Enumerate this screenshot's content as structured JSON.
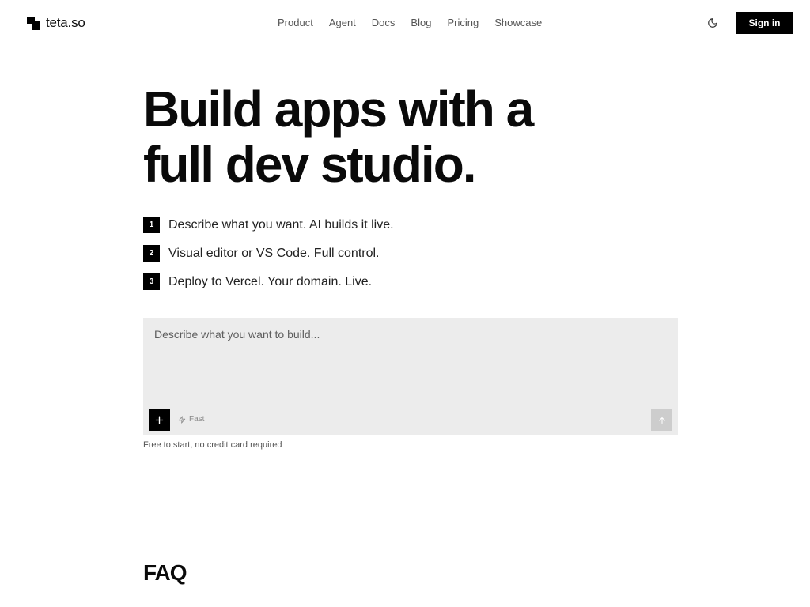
{
  "header": {
    "logo_text": "teta.so",
    "logo_icon": "teta-logo-icon",
    "nav": [
      {
        "label": "Product"
      },
      {
        "label": "Agent"
      },
      {
        "label": "Docs"
      },
      {
        "label": "Blog"
      },
      {
        "label": "Pricing"
      },
      {
        "label": "Showcase"
      }
    ],
    "theme_toggle_icon": "moon-icon",
    "sign_in_label": "Sign in"
  },
  "hero": {
    "title_lines": [
      "Build apps with a",
      "full dev studio."
    ],
    "steps": [
      {
        "number": "1",
        "text": "Describe what you want. AI builds it live."
      },
      {
        "number": "2",
        "text": "Visual editor or VS Code. Full control."
      },
      {
        "number": "3",
        "text": "Deploy to Vercel. Your domain. Live."
      }
    ]
  },
  "prompt": {
    "placeholder": "Describe what you want to build...",
    "value": "",
    "add_icon": "plus-icon",
    "mode_icon": "lightning-icon",
    "mode_label": "Fast",
    "submit_icon": "arrow-up-icon"
  },
  "signup_note": "Free to start, no credit card required",
  "faq": {
    "heading": "FAQ"
  },
  "colors": {
    "accent": "#000000",
    "surface": "#ececec",
    "text": "#0a0a0a",
    "muted": "#555555",
    "disabled": "#cdcdcd"
  }
}
